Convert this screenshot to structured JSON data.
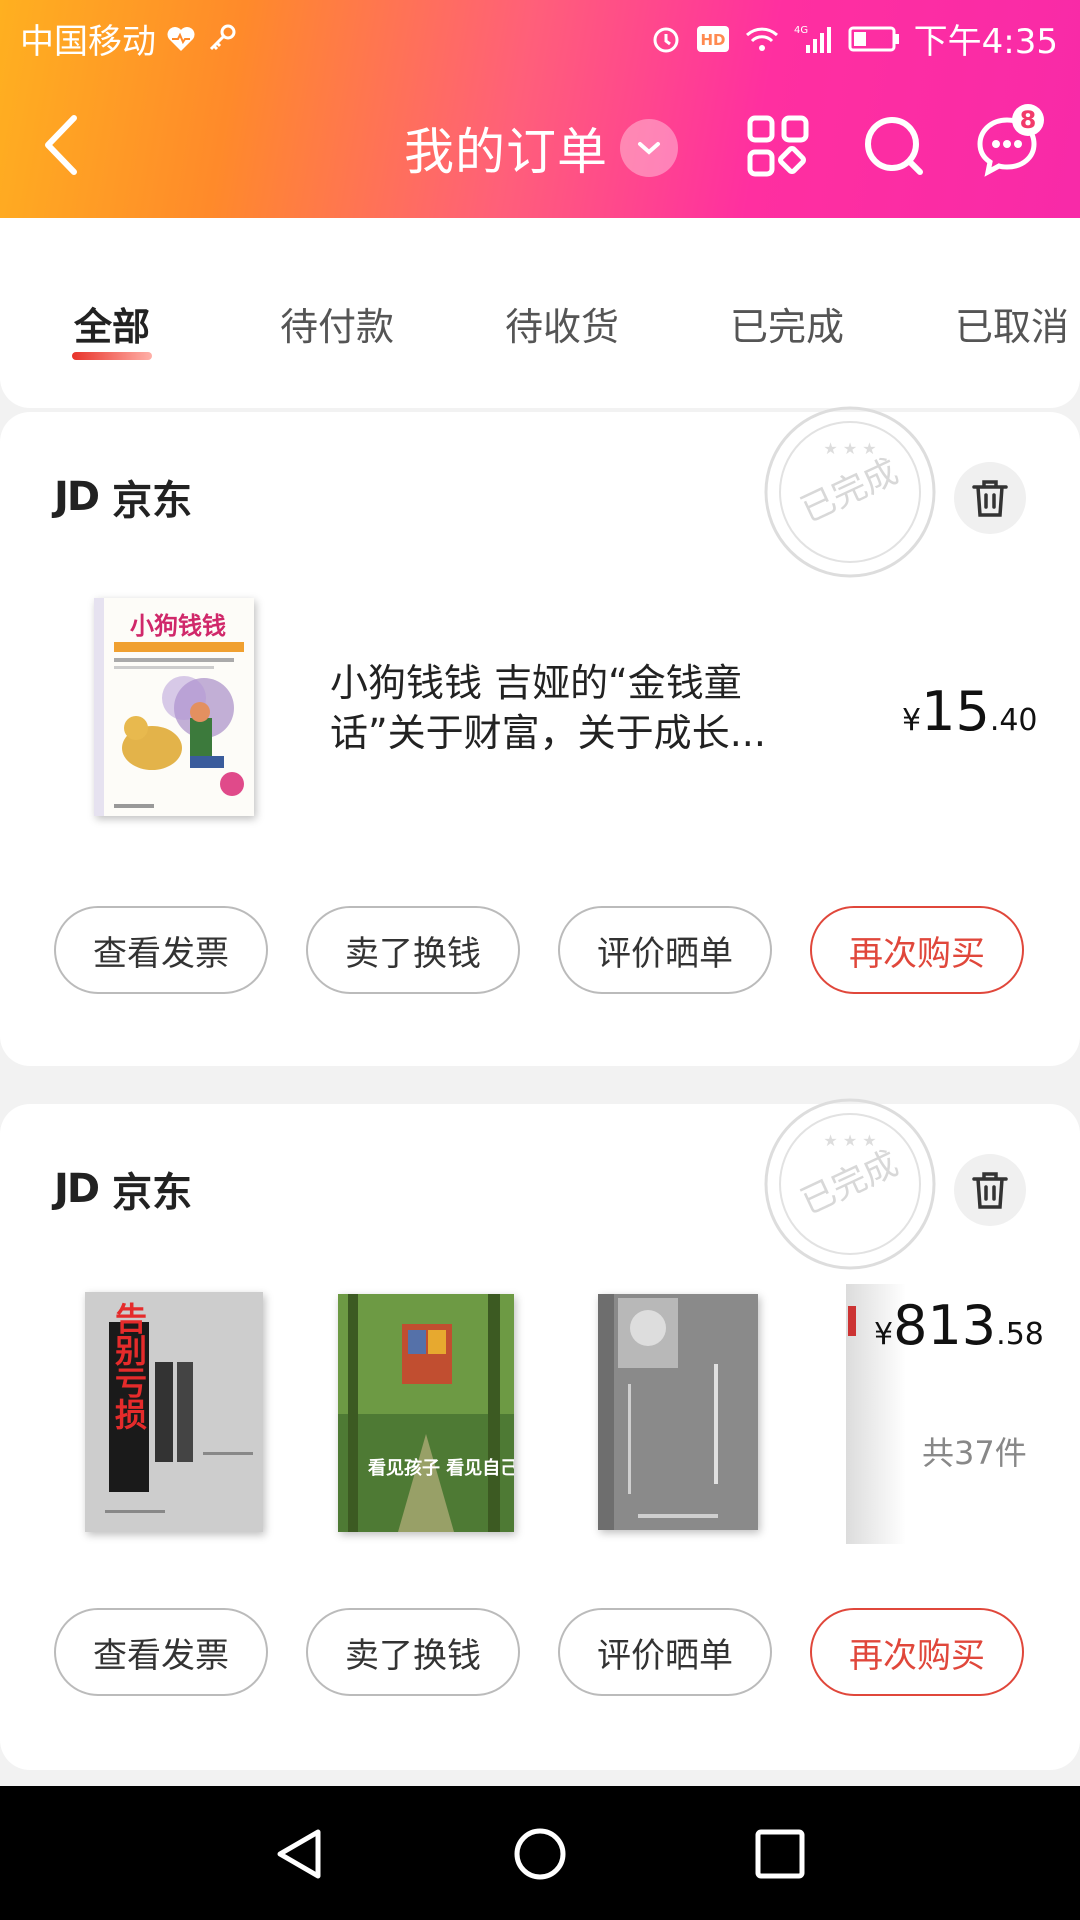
{
  "status_bar": {
    "carrier": "中国移动",
    "network": "4G",
    "time": "下午4:35"
  },
  "header": {
    "back_icon": "chevron-left-icon",
    "title": "我的订单"
  },
  "header_actions": {
    "message_badge": "8"
  },
  "tabs": [
    {
      "label": "全部",
      "active": true
    },
    {
      "label": "待付款",
      "active": false
    },
    {
      "label": "待收货",
      "active": false
    },
    {
      "label": "已完成",
      "active": false
    },
    {
      "label": "已取消",
      "active": false
    }
  ],
  "orders": [
    {
      "shop_logo": "JD",
      "shop_name": "京东",
      "stamp": "已完成",
      "book_cover_title": "小狗钱钱",
      "product_title": "小狗钱钱 吉娅的“金钱童话”关于财富，关于成长...",
      "price_currency": "¥",
      "price_int": "15",
      "price_dec": ".40",
      "buttons": [
        "查看发票",
        "卖了换钱",
        "评价晒单",
        "再次购买"
      ]
    },
    {
      "shop_logo": "JD",
      "shop_name": "京东",
      "stamp": "已完成",
      "book1_title": "告别亏损",
      "book2_title": "看见孩子 看见自己",
      "price_currency": "¥",
      "price_int": "813",
      "price_dec": ".58",
      "count": "共37件",
      "buttons": [
        "查看发票",
        "卖了换钱",
        "评价晒单",
        "再次购买"
      ]
    }
  ],
  "colors": {
    "accent_red": "#e0473b",
    "header_gradient_start": "#ffb020",
    "header_gradient_end": "#f82aa8"
  }
}
